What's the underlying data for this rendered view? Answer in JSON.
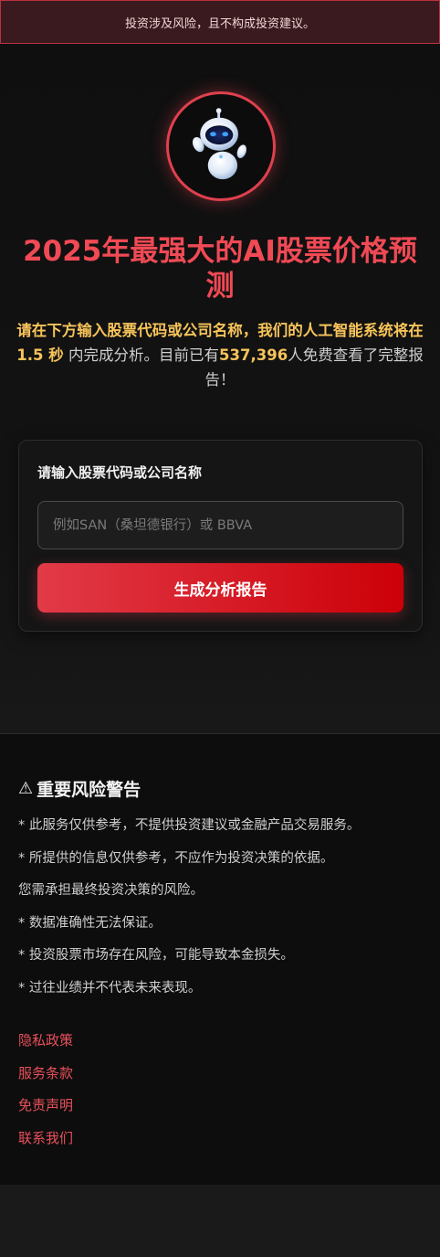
{
  "banner": {
    "text": "投资涉及风险，且不构成投资建议。"
  },
  "hero": {
    "title": "2025年最强大的AI股票价格预测",
    "subtitle": {
      "part1": "请在下方输入股票代码或公司名称，我们的人工智能系统将在1.5 秒",
      "part2": " 内完成分析。目前已有",
      "count": "537,396",
      "part3": "人免费查看了完整报告！"
    }
  },
  "form": {
    "label": "请输入股票代码或公司名称",
    "input_placeholder": "例如SAN（桑坦德银行）或 BBVA",
    "input_value": "",
    "button_label": "生成分析报告"
  },
  "footer": {
    "warning_icon": "⚠",
    "warning_title": "重要风险警告",
    "items": [
      "* 此服务仅供参考，不提供投资建议或金融产品交易服务。",
      "* 所提供的信息仅供参考，不应作为投资决策的依据。",
      "您需承担最终投资决策的风险。",
      "* 数据准确性无法保证。",
      "* 投资股票市场存在风险，可能导致本金损失。",
      "* 过往业绩并不代表未来表现。"
    ],
    "links": [
      "隐私政策",
      "服务条款",
      "免责声明",
      "联系我们"
    ]
  },
  "colors": {
    "accent": "#f04a55",
    "highlight": "#f7c45a",
    "button_start": "#e23a48",
    "button_end": "#cc0008",
    "link": "#e8505a"
  }
}
